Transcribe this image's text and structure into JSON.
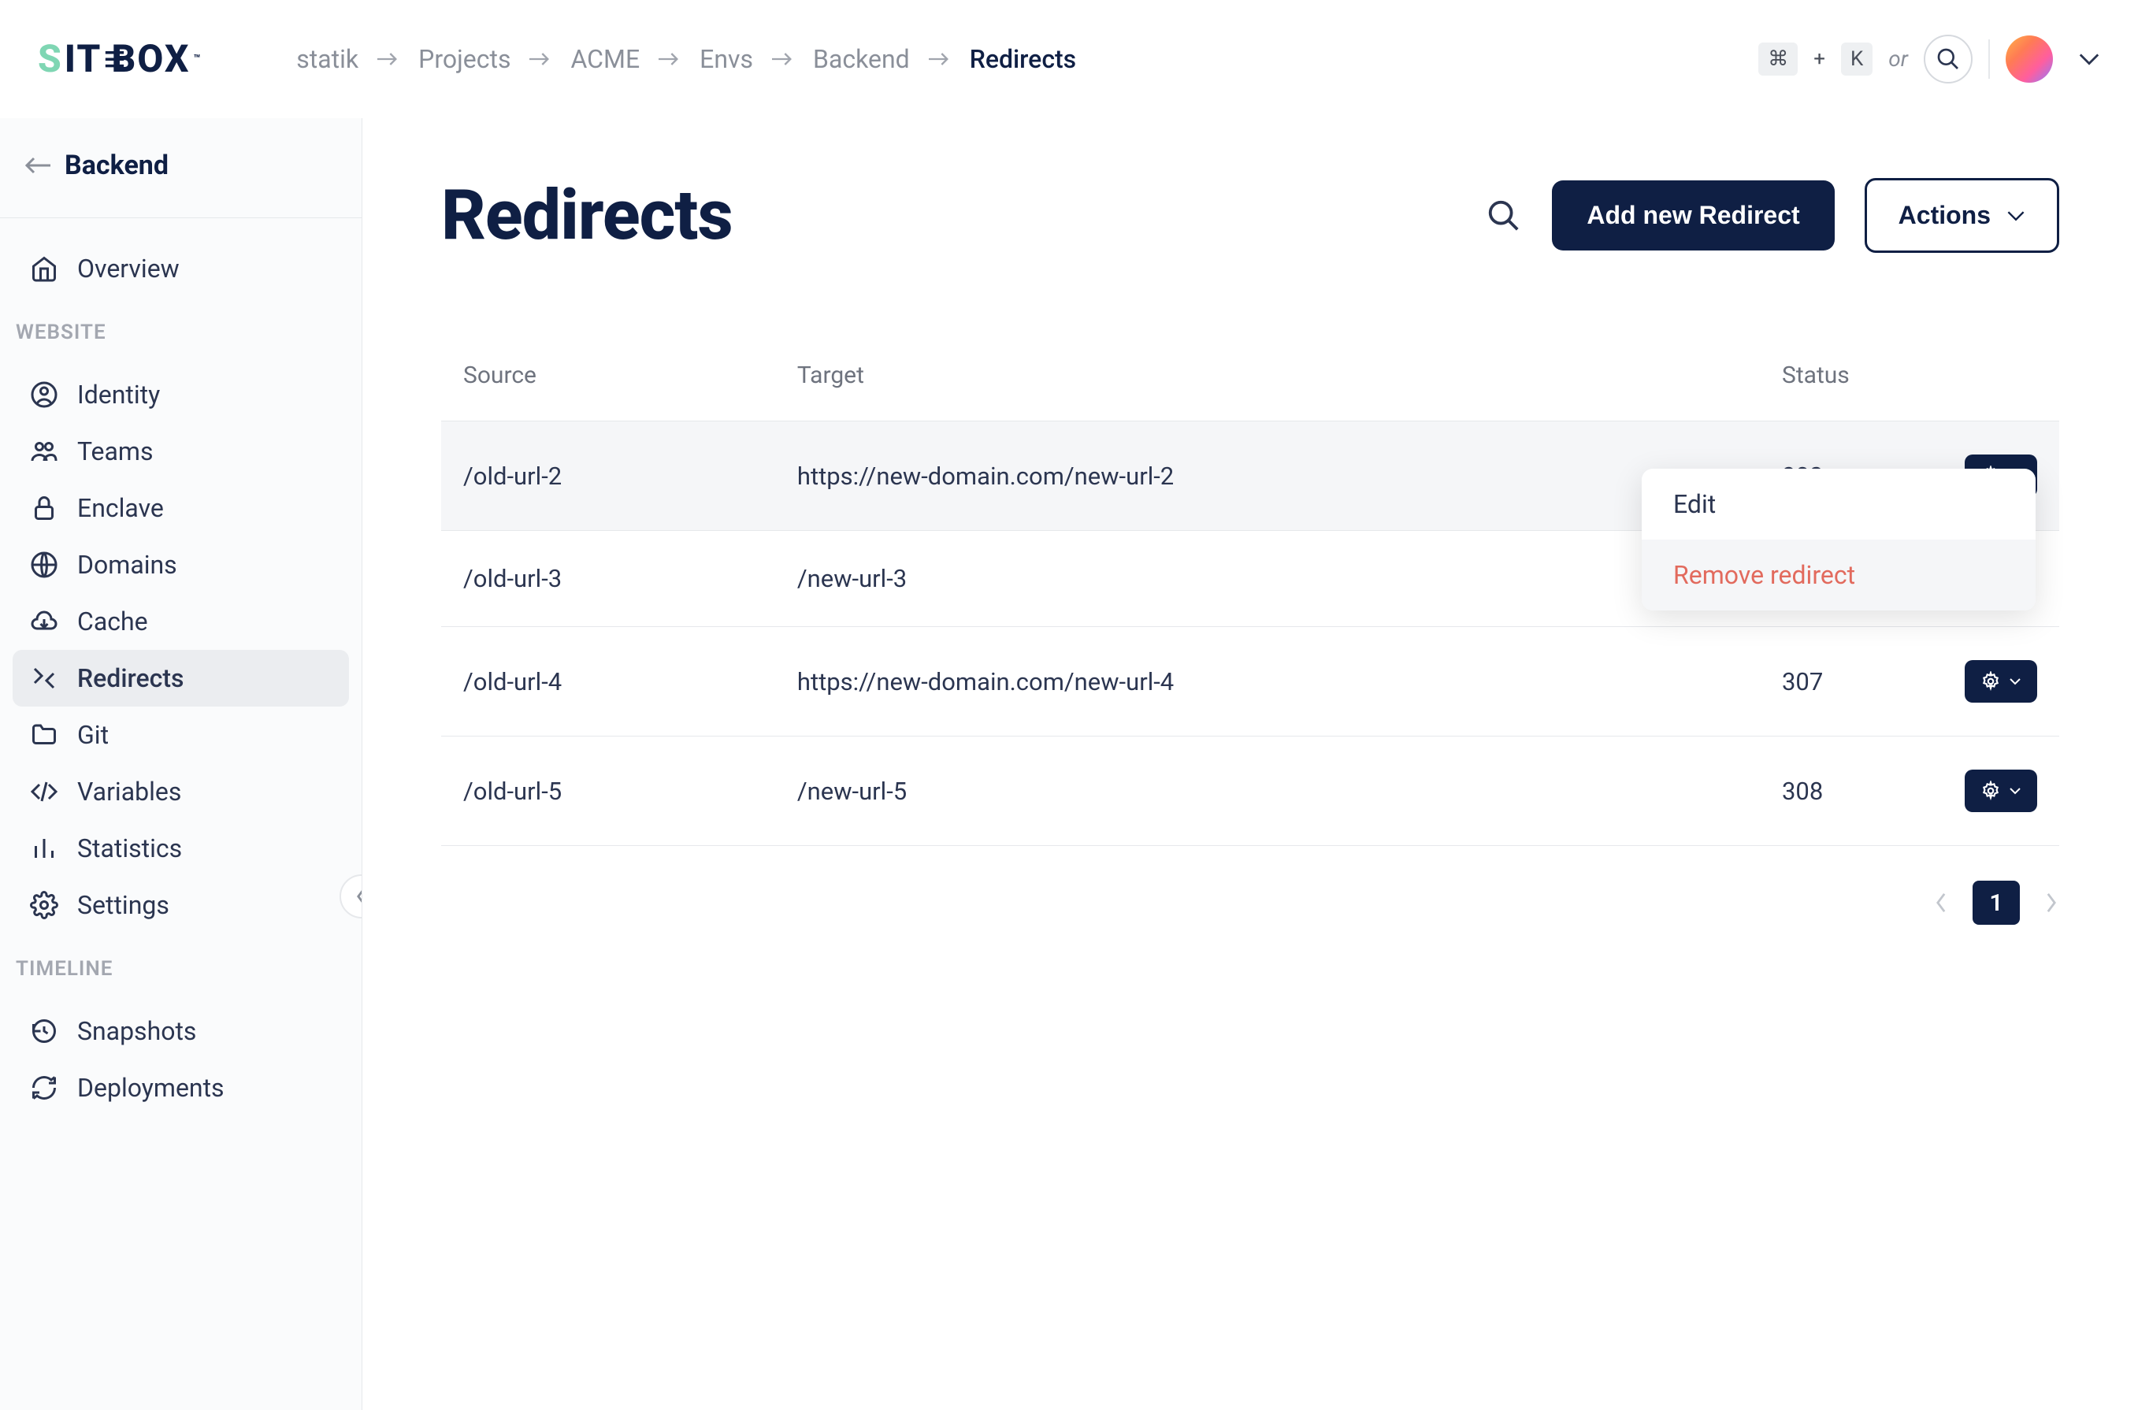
{
  "logo": {
    "text_part1": "SIT",
    "text_e": "E",
    "text_part2": "BOX",
    "tm": "™"
  },
  "breadcrumbs": [
    {
      "label": "statik"
    },
    {
      "label": "Projects"
    },
    {
      "label": "ACME"
    },
    {
      "label": "Envs"
    },
    {
      "label": "Backend"
    },
    {
      "label": "Redirects",
      "active": true
    }
  ],
  "header": {
    "cmd_key": "⌘",
    "plus": "+",
    "k_key": "K",
    "or": "or"
  },
  "sidebar": {
    "back_label": "Backend",
    "nav": {
      "overview": "Overview",
      "section_website": "WEBSITE",
      "identity": "Identity",
      "teams": "Teams",
      "enclave": "Enclave",
      "domains": "Domains",
      "cache": "Cache",
      "redirects": "Redirects",
      "git": "Git",
      "variables": "Variables",
      "statistics": "Statistics",
      "settings": "Settings",
      "section_timeline": "TIMELINE",
      "snapshots": "Snapshots",
      "deployments": "Deployments"
    }
  },
  "page": {
    "title": "Redirects",
    "add_button": "Add new Redirect",
    "actions_button": "Actions"
  },
  "table": {
    "col_source": "Source",
    "col_target": "Target",
    "col_status": "Status",
    "rows": [
      {
        "source": "/old-url-2",
        "target": "https://new-domain.com/new-url-2",
        "status": "302"
      },
      {
        "source": "/old-url-3",
        "target": "/new-url-3",
        "status": ""
      },
      {
        "source": "/old-url-4",
        "target": "https://new-domain.com/new-url-4",
        "status": "307"
      },
      {
        "source": "/old-url-5",
        "target": "/new-url-5",
        "status": "308"
      }
    ]
  },
  "dropdown": {
    "edit": "Edit",
    "remove": "Remove redirect"
  },
  "pagination": {
    "current": "1"
  }
}
